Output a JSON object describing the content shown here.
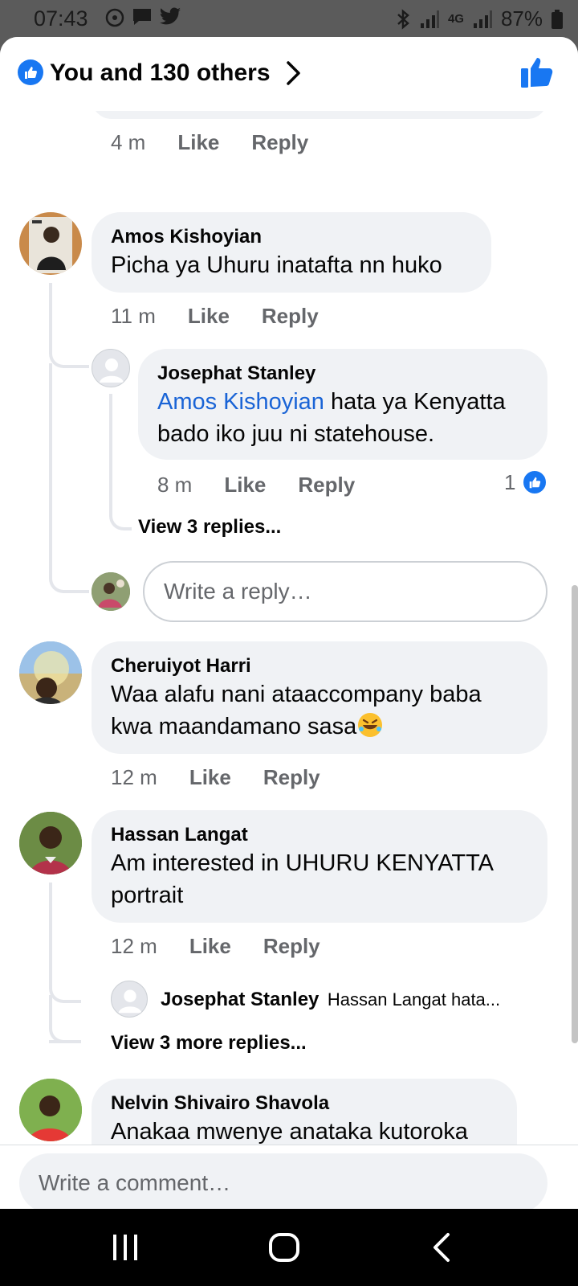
{
  "status_bar": {
    "time": "07:43",
    "network": "4G",
    "battery": "87%"
  },
  "header": {
    "reactions_label": "You and 130 others"
  },
  "prev_meta": {
    "time": "4 m",
    "like": "Like",
    "reply": "Reply"
  },
  "comments": [
    {
      "name": "Amos Kishoyian",
      "text": "Picha ya Uhuru inatafta nn huko",
      "time": "11 m",
      "like": "Like",
      "reply": "Reply"
    },
    {
      "name": "Cheruiyot Harri",
      "text_line1": "Waa alafu nani ataaccompany baba",
      "text_line2": "kwa maandamano sasa",
      "time": "12 m",
      "like": "Like",
      "reply": "Reply"
    },
    {
      "name": "Hassan Langat",
      "text_line1": "Am interested in UHURU KENYATTA",
      "text_line2": "portrait",
      "time": "12 m",
      "like": "Like",
      "reply": "Reply"
    },
    {
      "name": "Nelvin Shivairo Shavola",
      "text": "Anakaa mwenye anataka kutoroka"
    }
  ],
  "reply_1": {
    "name": "Josephat Stanley",
    "mention": "Amos Kishoyian",
    "text_after_mention": " hata ya Kenyatta",
    "text_line2": "bado iko juu ni statehouse.",
    "time": "8 m",
    "like": "Like",
    "reply": "Reply",
    "reaction_count": "1"
  },
  "view_replies_1": "View 3 replies...",
  "reply_input_placeholder": "Write a reply…",
  "reply_preview": {
    "name": "Josephat Stanley",
    "snippet": "Hassan Langat  hata..."
  },
  "view_more_replies": "View 3 more replies...",
  "comment_input_placeholder": "Write a comment…",
  "colors": {
    "accent": "#1877f2",
    "mention": "#1a64d6",
    "bubble": "#f0f2f5"
  },
  "icons": [
    "like-badge-icon",
    "chevron-right-icon",
    "thumbs-up-icon",
    "recents-icon",
    "home-icon",
    "back-icon"
  ]
}
